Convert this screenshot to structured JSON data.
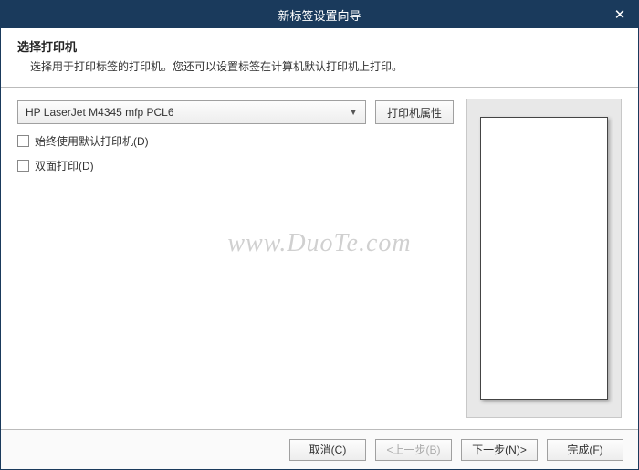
{
  "titlebar": {
    "title": "新标签设置向导"
  },
  "header": {
    "title": "选择打印机",
    "description": "选择用于打印标签的打印机。您还可以设置标签在计算机默认打印机上打印。"
  },
  "printer": {
    "selected": "HP LaserJet M4345 mfp PCL6",
    "properties_label": "打印机属性"
  },
  "options": {
    "always_default_label": "始终使用默认打印机(D)",
    "duplex_label": "双面打印(D)"
  },
  "footer": {
    "cancel": "取消(C)",
    "back": "<上一步(B)",
    "next": "下一步(N)>",
    "finish": "完成(F)"
  },
  "watermark": "www.DuoTe.com"
}
